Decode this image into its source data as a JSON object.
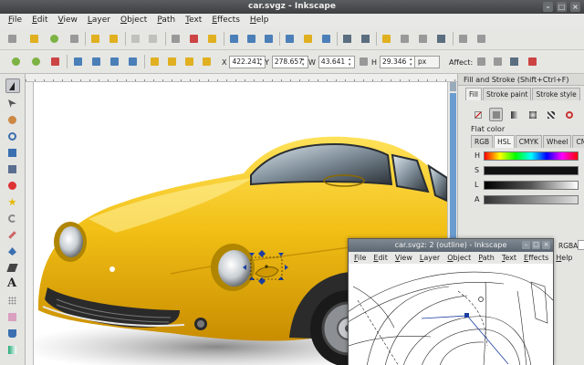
{
  "window": {
    "title": "car.svgz - Inkscape"
  },
  "menu": [
    "File",
    "Edit",
    "View",
    "Layer",
    "Object",
    "Path",
    "Text",
    "Effects",
    "Help"
  ],
  "toolbar2": {
    "x_label": "X",
    "x_value": "422.241",
    "y_label": "Y",
    "y_value": "278.657",
    "w_label": "W",
    "w_value": "43.641",
    "h_label": "H",
    "h_value": "29.346",
    "unit": "px",
    "affect_label": "Affect:"
  },
  "dock": {
    "title": "Fill and Stroke (Shift+Ctrl+F)",
    "tabs": [
      "Fill",
      "Stroke paint",
      "Stroke style"
    ],
    "flat_color_label": "Flat color",
    "color_tabs": [
      "RGB",
      "HSL",
      "CMYK",
      "Wheel",
      "CMS"
    ],
    "sliders": [
      "H",
      "S",
      "L",
      "A"
    ],
    "rgba_label": "RGBA:"
  },
  "outline_window": {
    "title": "car.svgz: 2 (outline) - Inkscape",
    "menu": [
      "File",
      "Edit",
      "View",
      "Layer",
      "Object",
      "Path",
      "Text",
      "Effects",
      "Help"
    ]
  },
  "colors": {
    "car_body": "#f2c016",
    "accent": "#6a9ccf"
  },
  "icons": [
    "selector-icon",
    "node-icon",
    "tweak-icon",
    "zoom-icon",
    "rect-icon",
    "3dbox-icon",
    "circle-icon",
    "star-icon",
    "spiral-icon",
    "pencil-icon",
    "pen-icon",
    "calligraphy-icon",
    "text-icon",
    "spray-icon",
    "eraser-icon",
    "bucket-icon",
    "gradient-icon",
    "dropper-icon"
  ]
}
